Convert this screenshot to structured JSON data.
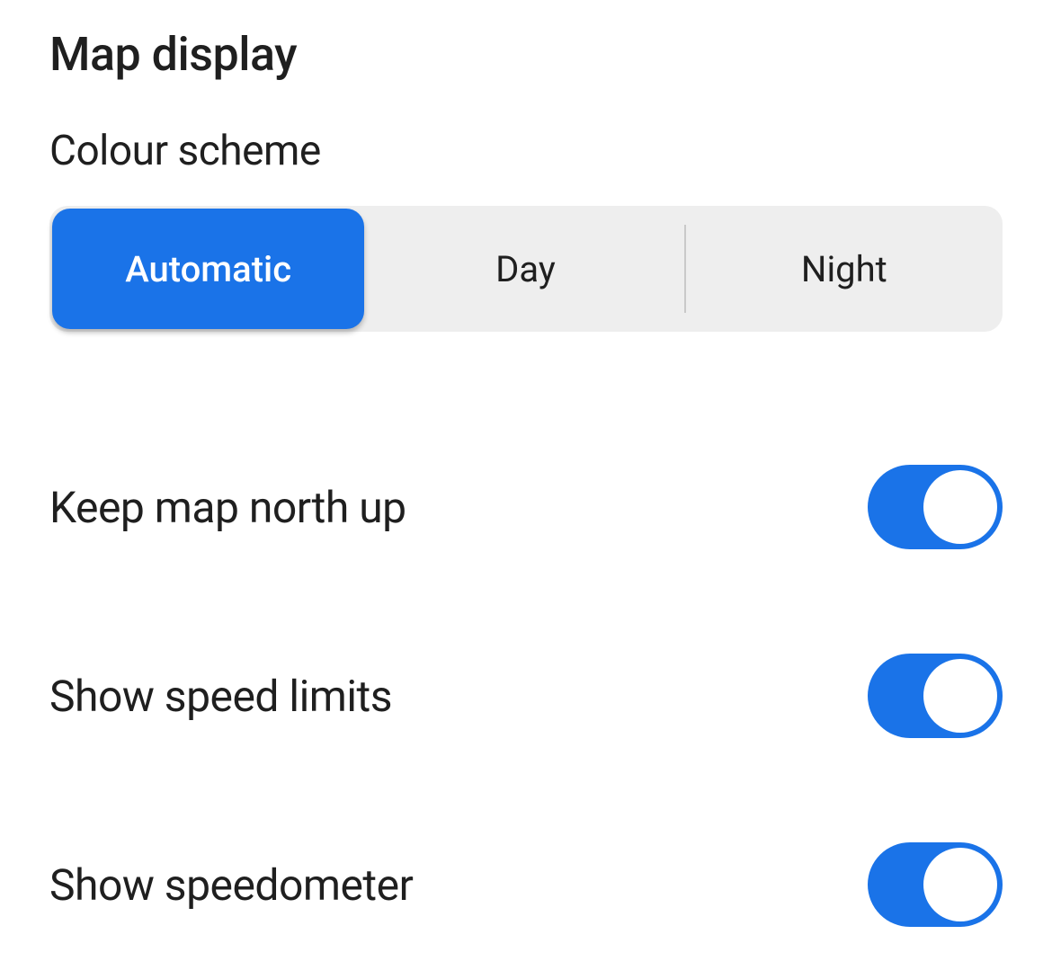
{
  "section": {
    "title": "Map display"
  },
  "colour_scheme": {
    "label": "Colour scheme",
    "options": {
      "automatic": "Automatic",
      "day": "Day",
      "night": "Night"
    },
    "selected": "automatic"
  },
  "settings": {
    "keep_north_up": {
      "label": "Keep map north up",
      "value": true
    },
    "show_speed_limits": {
      "label": "Show speed limits",
      "value": true
    },
    "show_speedometer": {
      "label": "Show speedometer",
      "value": true
    }
  },
  "colors": {
    "accent": "#1a73e8",
    "segmented_bg": "#eeeeee",
    "text": "#1f1f1f"
  }
}
